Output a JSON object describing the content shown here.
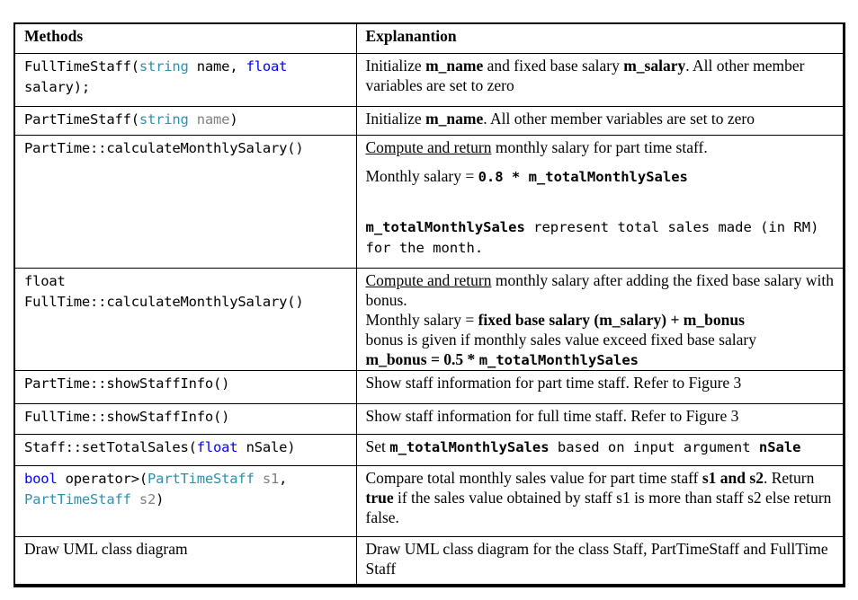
{
  "table": {
    "headers": {
      "methods": "Methods",
      "explanation": "Explanantion"
    },
    "rows": [
      {
        "method": {
          "name": "FullTimeStaff(",
          "t1": "string",
          "p1": " name, ",
          "t2": "float",
          "line2": "salary);"
        },
        "explanation": {
          "a": "Initialize ",
          "b1": "m_name",
          "c": " and fixed base salary ",
          "b2": "m_salary",
          "d": ". All other member variables are set to zero"
        }
      },
      {
        "method": {
          "name": "PartTimeStaff(",
          "t1": "string",
          "p1": " name",
          "close": ")"
        },
        "explanation": {
          "a": "Initialize ",
          "b1": "m_name",
          "d": ". All other member variables are set to zero"
        }
      },
      {
        "method": {
          "text": "PartTime::calculateMonthlySalary()"
        },
        "explanation": {
          "u": "Compute and return",
          "a": " monthly salary for part time staff.",
          "formula_label": "Monthly salary = ",
          "formula": "0.8 * m_totalMonthlySales",
          "note_b": "m_totalMonthlySales",
          "note": " represent total sales made (in RM) for the month."
        }
      },
      {
        "method": {
          "line1": "float",
          "line2": "FullTime::calculateMonthlySalary()"
        },
        "explanation": {
          "u": "Compute and return",
          "a": " monthly salary after adding the fixed base salary with bonus.",
          "formula_label": "Monthly salary = ",
          "formula": "fixed base salary (m_salary) + m_bonus",
          "bonus_note": "bonus is given if monthly sales value exceed fixed base salary",
          "bonus_label": "m_bonus = 0.5 * ",
          "bonus_var": "m_totalMonthlySales"
        }
      },
      {
        "method": {
          "text": "PartTime::showStaffInfo()"
        },
        "explanation": {
          "a": "Show staff information for part time staff. Refer to Figure 3"
        }
      },
      {
        "method": {
          "text": "FullTime::showStaffInfo()"
        },
        "explanation": {
          "a": "Show staff information for full time staff. Refer to Figure 3"
        }
      },
      {
        "method": {
          "name": "Staff::setTotalSales(",
          "t1": "float",
          "p1": " nSale)"
        },
        "explanation": {
          "a": "Set ",
          "b1": "m_totalMonthlySales",
          "c": " based on input argument ",
          "b2": "nSale"
        }
      },
      {
        "method": {
          "kw": "bool",
          "op": " operator>(",
          "t1": "PartTimeStaff",
          "p1": " s1",
          "comma": ",",
          "t2": "PartTimeStaff",
          "p2": " s2",
          "close": ")"
        },
        "explanation": {
          "a": "Compare total monthly sales value for part time staff ",
          "b1": "s1 and s2",
          "c": ". Return ",
          "b2": "true",
          "d": " if the sales value obtained by staff s1 is more than staff s2 else return false."
        }
      },
      {
        "method": {
          "text": "Draw UML class diagram"
        },
        "explanation": {
          "a": "Draw UML class diagram for the class Staff, PartTimeStaff and FullTime Staff"
        }
      }
    ]
  }
}
